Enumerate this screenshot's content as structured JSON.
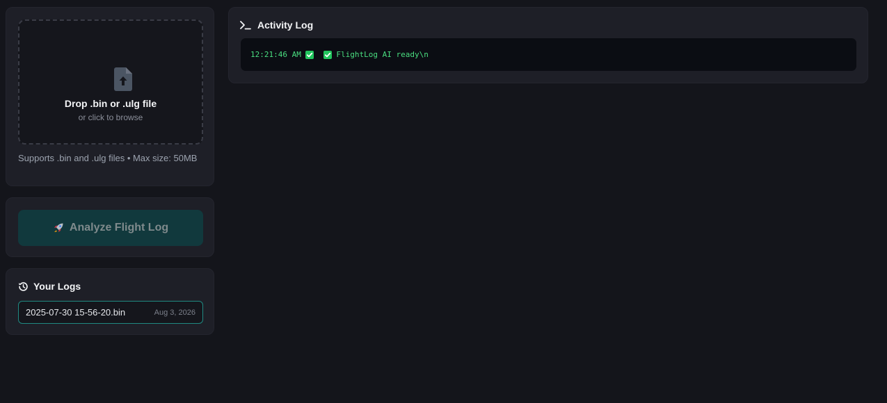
{
  "upload": {
    "title": "Drop .bin or .ulg file",
    "subtitle": "or click to browse",
    "supports": "Supports .bin and .ulg files • Max size: 50MB",
    "icon": "file-upload-icon"
  },
  "analyze": {
    "label": "Analyze Flight Log",
    "icon": "rocket-icon",
    "enabled": false
  },
  "logs": {
    "title": "Your Logs",
    "icon": "history-icon",
    "items": [
      {
        "name": "2025-07-30 15-56-20.bin",
        "date": "Aug 3, 2026"
      }
    ]
  },
  "activity": {
    "title": "Activity Log",
    "icon": "terminal-icon",
    "entries": [
      {
        "time": "12:21:46 AM",
        "message": "FlightLog AI ready\\n"
      }
    ]
  },
  "colors": {
    "background": "#14151b",
    "panel": "#1e1f27",
    "accent": "#1f8a82",
    "console_text": "#4ade80"
  }
}
